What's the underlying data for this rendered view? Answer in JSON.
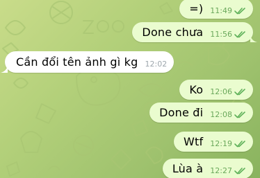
{
  "colors": {
    "out_bubble": "#eafccf",
    "in_bubble": "#ffffff",
    "out_time": "#6aa85b",
    "in_time": "#9ea7ad",
    "tick": "#5fb15a"
  },
  "messages": [
    {
      "direction": "out",
      "text": "=)",
      "time": "11:49",
      "read": true
    },
    {
      "direction": "out",
      "text": "Done chưa",
      "time": "11:56",
      "read": true
    },
    {
      "direction": "in",
      "text": "Cần đổi tên ảnh gì kg",
      "time": "12:02"
    },
    {
      "direction": "out",
      "text": "Ko",
      "time": "12:06",
      "read": true
    },
    {
      "direction": "out",
      "text": "Done đi",
      "time": "12:08",
      "read": true
    },
    {
      "direction": "out",
      "text": "Wtf",
      "time": "12:19",
      "read": true
    },
    {
      "direction": "out",
      "text": "Lùa à",
      "time": "12:27",
      "read": true
    }
  ]
}
